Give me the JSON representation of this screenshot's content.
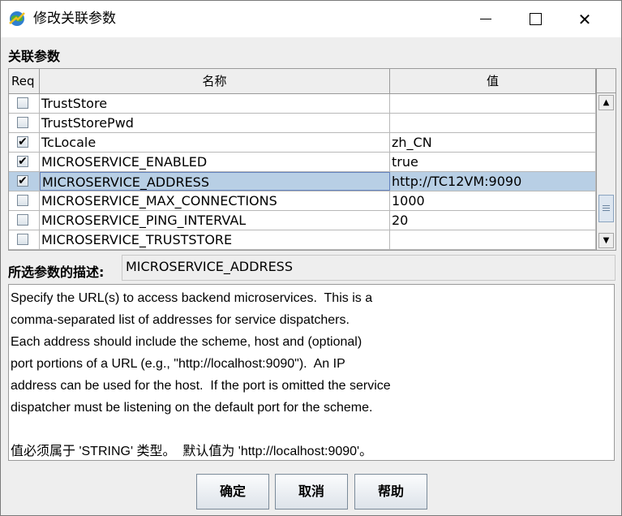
{
  "window": {
    "title": "修改关联参数",
    "icons": {
      "app": "globe-app-icon",
      "minimize": "minimize-icon",
      "maximize": "maximize-icon",
      "close": "close-icon"
    },
    "close_glyph": "✕"
  },
  "section": {
    "label": "关联参数"
  },
  "table": {
    "headers": {
      "req": "Req",
      "name": "名称",
      "value": "值"
    },
    "rows": [
      {
        "checked": false,
        "name": "TrustStore",
        "value": ""
      },
      {
        "checked": false,
        "name": "TrustStorePwd",
        "value": ""
      },
      {
        "checked": true,
        "name": "TcLocale",
        "value": "zh_CN"
      },
      {
        "checked": true,
        "name": "MICROSERVICE_ENABLED",
        "value": "true"
      },
      {
        "checked": true,
        "name": "MICROSERVICE_ADDRESS",
        "value": "http://TC12VM:9090",
        "selected": true
      },
      {
        "checked": false,
        "name": "MICROSERVICE_MAX_CONNECTIONS",
        "value": "1000"
      },
      {
        "checked": false,
        "name": "MICROSERVICE_PING_INTERVAL",
        "value": "20"
      },
      {
        "checked": false,
        "name": "MICROSERVICE_TRUSTSTORE",
        "value": ""
      }
    ],
    "check_glyph": "✔",
    "scroll": {
      "up_glyph": "▲",
      "down_glyph": "▼"
    }
  },
  "description": {
    "label": "所选参数的描述:",
    "param_name": "MICROSERVICE_ADDRESS",
    "text": "Specify the URL(s) to access backend microservices.  This is a\ncomma-separated list of addresses for service dispatchers.\nEach address should include the scheme, host and (optional)\nport portions of a URL (e.g., \"http://localhost:9090\").  An IP\naddress can be used for the host.  If the port is omitted the service\ndispatcher must be listening on the default port for the scheme.\n\n值必须属于 'STRING' 类型。  默认值为 'http://localhost:9090'。"
  },
  "buttons": {
    "ok": "确定",
    "cancel": "取消",
    "help": "帮助"
  }
}
